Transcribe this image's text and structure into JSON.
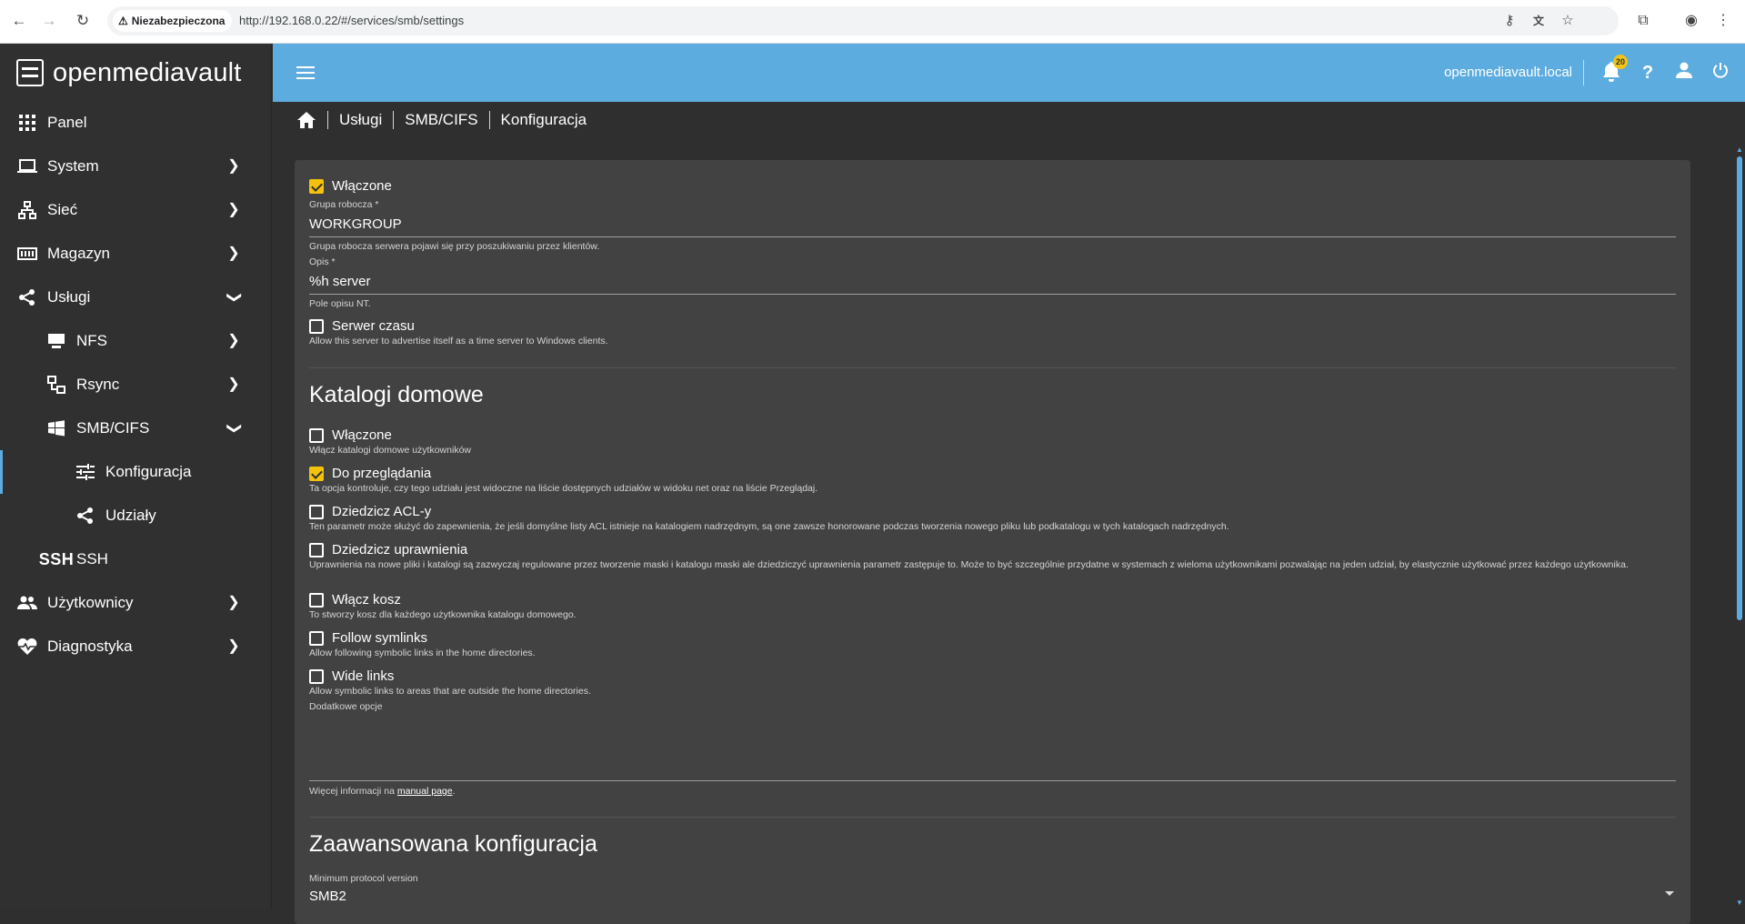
{
  "browser": {
    "security_label": "Niezabezpieczona",
    "url": "http://192.168.0.22/#/services/smb/settings"
  },
  "sidebar": {
    "brand": "openmediavault",
    "items": [
      {
        "label": "Panel"
      },
      {
        "label": "System"
      },
      {
        "label": "Sieć"
      },
      {
        "label": "Magazyn"
      },
      {
        "label": "Usługi"
      },
      {
        "label": "NFS"
      },
      {
        "label": "Rsync"
      },
      {
        "label": "SMB/CIFS"
      },
      {
        "label": "Konfiguracja"
      },
      {
        "label": "Udziały"
      },
      {
        "label": "SSH"
      },
      {
        "label": "Użytkownicy"
      },
      {
        "label": "Diagnostyka"
      }
    ],
    "ssh_icon_text": "SSH"
  },
  "topbar": {
    "hostname": "openmediavault.local",
    "notification_count": "20"
  },
  "breadcrumb": [
    "Usługi",
    "SMB/CIFS",
    "Konfiguracja"
  ],
  "form": {
    "enabled": {
      "label": "Włączone",
      "checked": true
    },
    "workgroup": {
      "label": "Grupa robocza *",
      "value": "WORKGROUP",
      "hint": "Grupa robocza serwera pojawi się przy poszukiwaniu przez klientów."
    },
    "description": {
      "label": "Opis *",
      "value": "%h server",
      "hint": "Pole opisu NT."
    },
    "time_server": {
      "label": "Serwer czasu",
      "hint": "Allow this server to advertise itself as a time server to Windows clients."
    },
    "homes": {
      "title": "Katalogi domowe",
      "enabled": {
        "label": "Włączone",
        "hint": "Włącz katalogi domowe użytkowników"
      },
      "browseable": {
        "label": "Do przeglądania",
        "hint": "Ta opcja kontroluje, czy tego udziału jest widoczne na liście dostępnych udziałów w widoku net oraz na liście Przeglądaj."
      },
      "inherit_acls": {
        "label": "Dziedzicz ACL-y",
        "hint": "Ten parametr może służyć do zapewnienia, że jeśli domyślne listy ACL istnieje na katalogiem nadrzędnym, są one zawsze honorowane podczas tworzenia nowego pliku lub podkatalogu w tych katalogach nadrzędnych."
      },
      "inherit_perms": {
        "label": "Dziedzicz uprawnienia",
        "hint": "Uprawnienia na nowe pliki i katalogi są zazwyczaj regulowane przez tworzenie maski i katalogu maski ale dziedziczyć uprawnienia parametr zastępuje to. Może to być szczególnie przydatne w systemach z wieloma użytkownikami pozwalając na jeden udział, by elastycznie użytkować przez każdego użytkownika."
      },
      "recycle_bin": {
        "label": "Włącz kosz",
        "hint": "To stworzy kosz dla każdego użytkownika katalogu domowego."
      },
      "follow_symlinks": {
        "label": "Follow symlinks",
        "hint": "Allow following symbolic links in the home directories."
      },
      "wide_links": {
        "label": "Wide links",
        "hint": "Allow symbolic links to areas that are outside the home directories."
      },
      "extra_options": {
        "label": "Dodatkowe opcje",
        "hint_prefix": "Więcej informacji na",
        "hint_link": "manual page",
        "hint_suffix": "."
      }
    },
    "advanced": {
      "title": "Zaawansowana konfiguracja",
      "min_protocol": {
        "label": "Minimum protocol version",
        "value": "SMB2"
      }
    }
  },
  "colors": {
    "accent": "#5dacdf",
    "checkbox": "#f4c20d",
    "badge": "#f0c419",
    "background": "#2f2f2f",
    "card": "#424242"
  }
}
